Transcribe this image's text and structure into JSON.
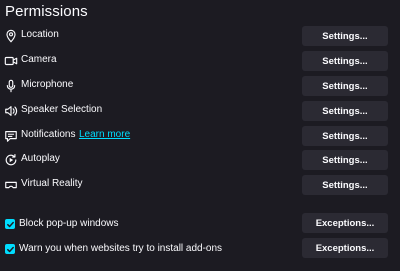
{
  "section": {
    "title": "Permissions"
  },
  "permissions": [
    {
      "label": "Location",
      "icon": "location-pin-icon",
      "button": "Settings..."
    },
    {
      "label": "Camera",
      "icon": "camera-icon",
      "button": "Settings..."
    },
    {
      "label": "Microphone",
      "icon": "microphone-icon",
      "button": "Settings..."
    },
    {
      "label": "Speaker Selection",
      "icon": "speaker-icon",
      "button": "Settings..."
    },
    {
      "label": "Notifications",
      "icon": "notification-icon",
      "link": "Learn more",
      "button": "Settings..."
    },
    {
      "label": "Autoplay",
      "icon": "autoplay-icon",
      "button": "Settings..."
    },
    {
      "label": "Virtual Reality",
      "icon": "vr-headset-icon",
      "button": "Settings..."
    }
  ],
  "checkboxes": [
    {
      "label": "Block pop-up windows",
      "checked": true,
      "button": "Exceptions..."
    },
    {
      "label": "Warn you when websites try to install add-ons",
      "checked": true,
      "button": "Exceptions..."
    }
  ],
  "colors": {
    "background": "#1c1b22",
    "button": "#2b2a33",
    "accent": "#00ddff",
    "text": "#fbfbfe"
  }
}
